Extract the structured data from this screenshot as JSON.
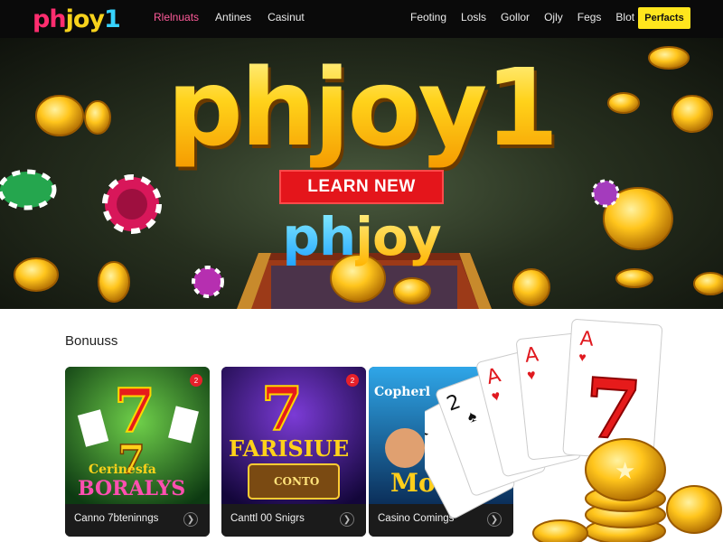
{
  "brand": {
    "logo_a": "ph",
    "logo_b": "joy",
    "logo_c": "1"
  },
  "nav": {
    "left_items": [
      "Rlelnuats",
      "Antines",
      "Casinut"
    ],
    "right_items": [
      "Feoting",
      "Losls",
      "Gollor",
      "Ojly",
      "Fegs",
      "Blot"
    ],
    "cta": "Perfacts"
  },
  "hero": {
    "title": "phjoy1",
    "cta": "LEARN NEW",
    "sub_a": "ph",
    "sub_b": "joy"
  },
  "section": {
    "title": "Bonuuss"
  },
  "cards": [
    {
      "label": "Canno 7bteninngs",
      "badge": "2",
      "art_line1": "Cerinesfa",
      "art_line2": "BORALYS"
    },
    {
      "label": "Canttl 00 Snigrs",
      "badge": "2",
      "art_line1": "FARISIUE",
      "art_line2": "CONTO"
    },
    {
      "label": "Casino Comings",
      "art_line1": "Copherl",
      "art_line2": "Mows"
    }
  ],
  "icons": [
    "chevron-right-icon",
    "badge-icon",
    "coin-icon",
    "poker-chip-icon",
    "playing-card-icon"
  ],
  "colors": {
    "nav_bg": "#0a0a0a",
    "cta_yellow": "#ffe61d",
    "hero_red": "#e4151b",
    "gold": "#ffc21a"
  }
}
